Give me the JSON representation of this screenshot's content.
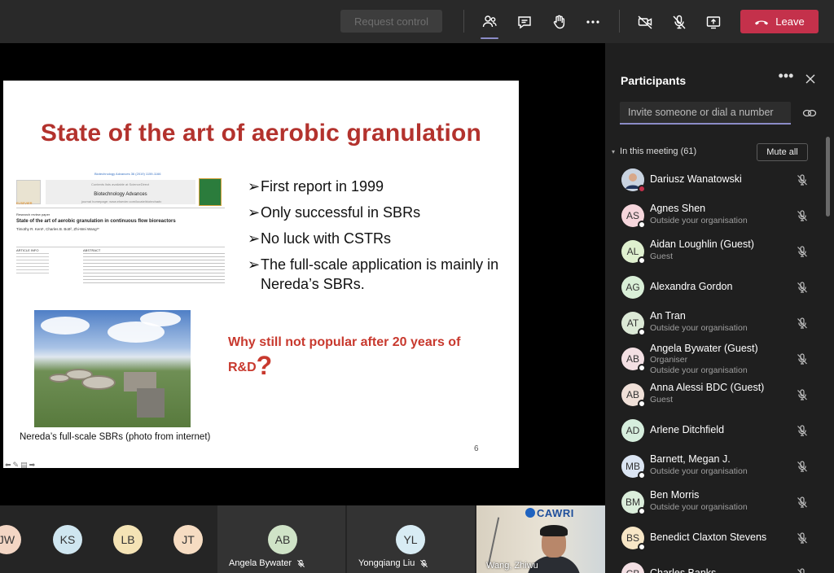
{
  "toolbar": {
    "request_control_label": "Request control",
    "leave_label": "Leave",
    "icons": [
      "participants-icon",
      "chat-icon",
      "raise-hand-icon",
      "more-options-icon",
      "camera-off-icon",
      "mic-off-icon",
      "share-screen-icon",
      "phone-hangup-icon"
    ]
  },
  "slide": {
    "title": "State of the art of aerobic granulation",
    "paper": {
      "journal_top": "Biotechnology Advances 36 (2019) 1159-1166",
      "contents_line": "Contents lists available at ScienceDirect",
      "journal_name": "Biotechnology Advances",
      "homepage": "journal homepage: www.elsevier.com/locate/biotechadv",
      "publisher": "ELSEVIER",
      "type": "Research review paper",
      "title": "State of the art of aerobic granulation in continuous flow bioreactors",
      "authors": "Timothy R. Kent¹, Charles B. Bott², Zhi-Wei Wang¹*",
      "article_info": "ARTICLE INFO",
      "abstract": "ABSTRACT"
    },
    "bullets": [
      "First report in 1999",
      "Only successful in SBRs",
      "No luck with CSTRs",
      "The full-scale application is mainly in Nereda’s SBRs."
    ],
    "question_text": "Why still not popular after 20 years of R&D",
    "question_mark": "?",
    "photo_caption": "Nereda’s full-scale SBRs (photo from internet)",
    "page_number": "6"
  },
  "gallery": {
    "small_avatars": [
      {
        "initials": "JW",
        "color": "#f3d6c4"
      },
      {
        "initials": "KS",
        "color": "#cfe6f0"
      },
      {
        "initials": "LB",
        "color": "#f4e3b5"
      },
      {
        "initials": "JT",
        "color": "#f6dcc2"
      }
    ],
    "tiles": [
      {
        "initials": "AB",
        "name": "Angela Bywater",
        "color": "#cfe3c7"
      },
      {
        "initials": "YL",
        "name": "Yongqiang Liu",
        "color": "#d8ecf4"
      }
    ],
    "video": {
      "name": "Wang, Zhiwu",
      "banner": "CAWRI"
    }
  },
  "panel": {
    "title": "Participants",
    "invite_placeholder": "Invite someone or dial a number",
    "in_meeting_label": "In this meeting (61)",
    "mute_all_label": "Mute all",
    "participants": [
      {
        "initials": "DW",
        "name": "Dariusz Wanatowski",
        "sub": "",
        "color": "#6d7f99",
        "photo": true,
        "status": "red"
      },
      {
        "initials": "AS",
        "name": "Agnes Shen",
        "sub": "Outside your organisation",
        "color": "#f6d6dc",
        "status": "white"
      },
      {
        "initials": "AL",
        "name": "Aidan Loughlin (Guest)",
        "sub": "Guest",
        "color": "#dff0cf",
        "status": "white"
      },
      {
        "initials": "AG",
        "name": "Alexandra Gordon",
        "sub": "",
        "color": "#d9efd7",
        "status": "none"
      },
      {
        "initials": "AT",
        "name": "An Tran",
        "sub": "Outside your organisation",
        "color": "#dce9d6",
        "status": "white"
      },
      {
        "initials": "AB",
        "name": "Angela Bywater (Guest)",
        "sub": "Organiser",
        "sub2": "Outside your organisation",
        "color": "#f3dfe3",
        "status": "white"
      },
      {
        "initials": "AB",
        "name": "Anna Alessi BDC (Guest)",
        "sub": "Guest",
        "color": "#f0e0d8",
        "status": "white"
      },
      {
        "initials": "AD",
        "name": "Arlene Ditchfield",
        "sub": "",
        "color": "#d6eedd",
        "status": "none"
      },
      {
        "initials": "MB",
        "name": "Barnett, Megan J.",
        "sub": "Outside your organisation",
        "color": "#dbe5f3",
        "status": "white"
      },
      {
        "initials": "BM",
        "name": "Ben Morris",
        "sub": "Outside your organisation",
        "color": "#dbeedb",
        "status": "white"
      },
      {
        "initials": "BS",
        "name": "Benedict Claxton Stevens",
        "sub": "",
        "color": "#f7e6c6",
        "status": "white"
      },
      {
        "initials": "CB",
        "name": "Charles Banks",
        "sub": "",
        "color": "#f3dfe3",
        "status": "white"
      }
    ]
  }
}
